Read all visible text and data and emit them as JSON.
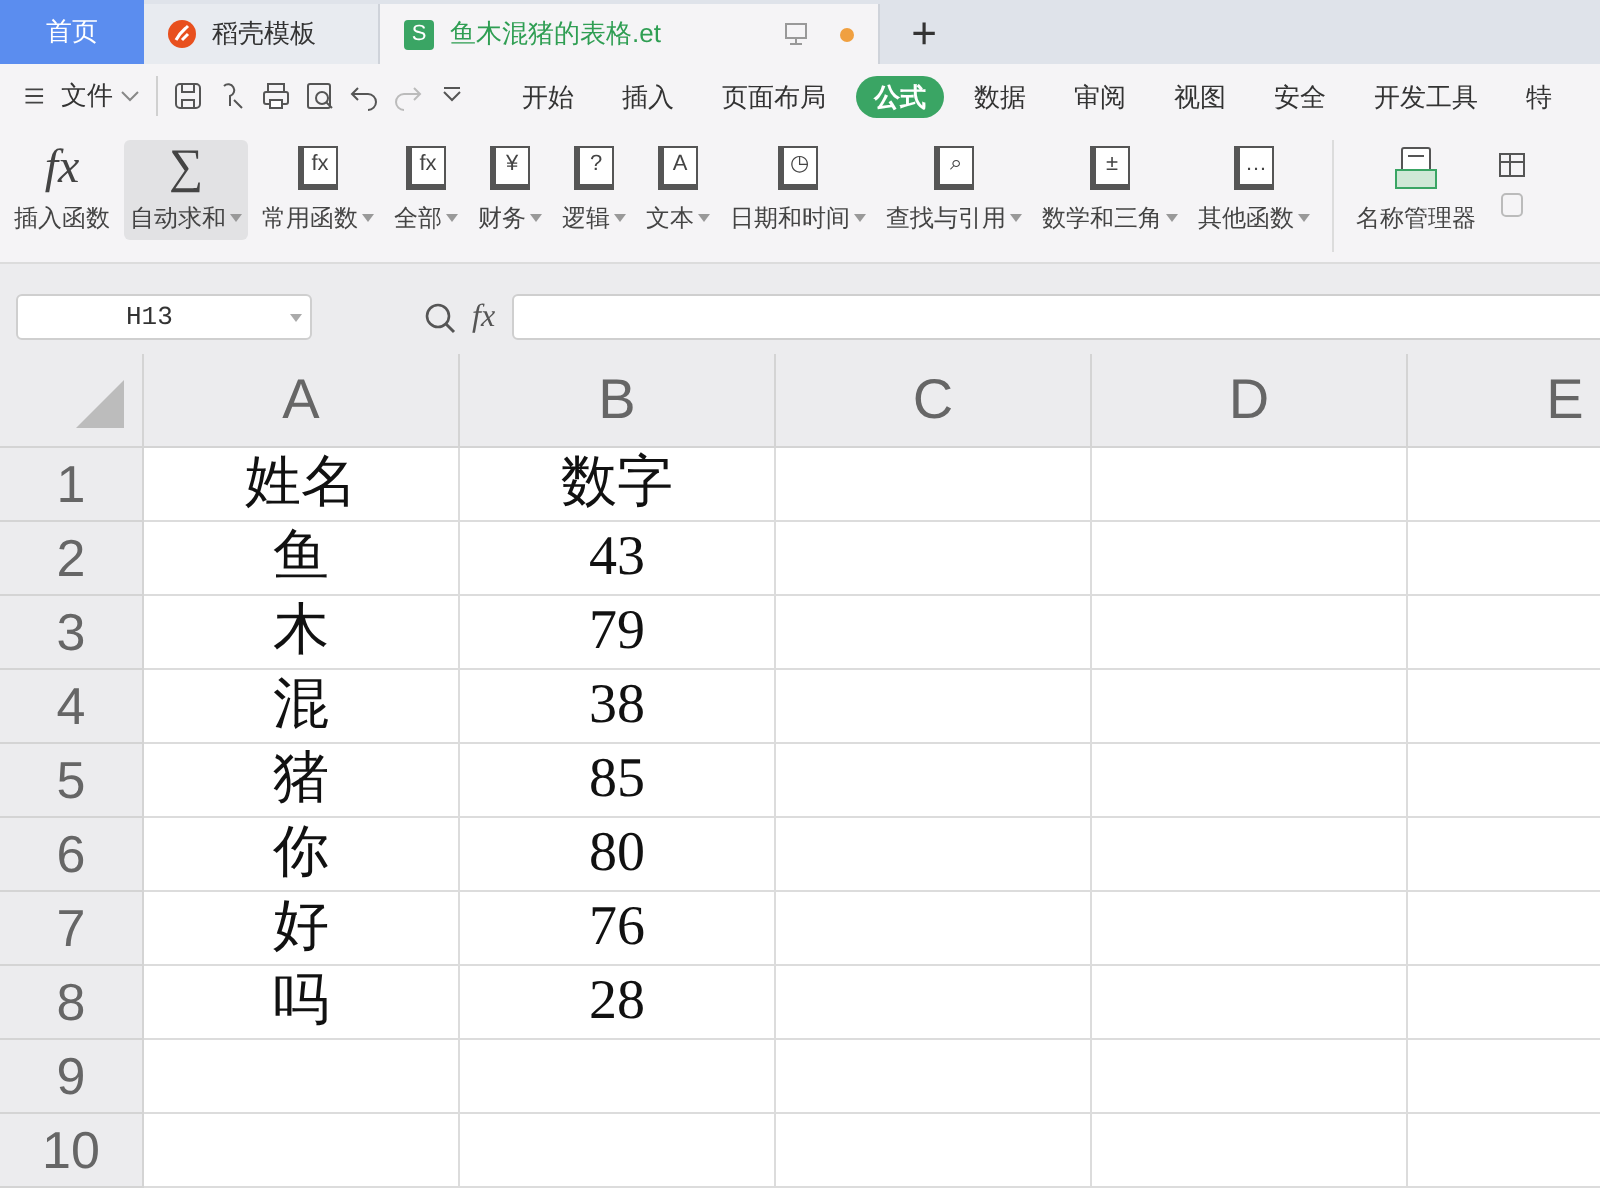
{
  "tabs": [
    {
      "kind": "home",
      "label": "首页",
      "selected": false
    },
    {
      "kind": "template",
      "label": "稻壳模板",
      "selected": false
    },
    {
      "kind": "sheet",
      "label": "鱼木混猪的表格.et",
      "icon_glyph": "S",
      "selected": true,
      "modified": true
    }
  ],
  "new_tab": "+",
  "menu": {
    "file": "文件",
    "tabs": [
      {
        "label": "开始",
        "selected": false
      },
      {
        "label": "插入",
        "selected": false
      },
      {
        "label": "页面布局",
        "selected": false
      },
      {
        "label": "公式",
        "selected": true
      },
      {
        "label": "数据",
        "selected": false
      },
      {
        "label": "审阅",
        "selected": false
      },
      {
        "label": "视图",
        "selected": false
      },
      {
        "label": "安全",
        "selected": false
      },
      {
        "label": "开发工具",
        "selected": false
      },
      {
        "label": "特",
        "selected": false
      }
    ]
  },
  "ribbon": [
    {
      "kind": "glyph",
      "glyph": "fx",
      "label": "插入函数",
      "dropdown": false,
      "selected": false
    },
    {
      "kind": "glyph",
      "glyph": "∑",
      "label": "自动求和",
      "dropdown": true,
      "selected": true
    },
    {
      "kind": "book",
      "glyph": "fx",
      "label": "常用函数",
      "dropdown": true,
      "selected": false
    },
    {
      "kind": "book",
      "glyph": "fx",
      "label": "全部",
      "dropdown": true,
      "selected": false
    },
    {
      "kind": "book",
      "glyph": "¥",
      "label": "财务",
      "dropdown": true,
      "selected": false
    },
    {
      "kind": "book",
      "glyph": "?",
      "label": "逻辑",
      "dropdown": true,
      "selected": false
    },
    {
      "kind": "book",
      "glyph": "A",
      "label": "文本",
      "dropdown": true,
      "selected": false
    },
    {
      "kind": "book",
      "glyph": "◷",
      "label": "日期和时间",
      "dropdown": true,
      "selected": false
    },
    {
      "kind": "book",
      "glyph": "⌕",
      "label": "查找与引用",
      "dropdown": true,
      "selected": false
    },
    {
      "kind": "book",
      "glyph": "±",
      "label": "数学和三角",
      "dropdown": true,
      "selected": false
    },
    {
      "kind": "book",
      "glyph": "…",
      "label": "其他函数",
      "dropdown": true,
      "selected": false
    },
    {
      "kind": "names",
      "label": "名称管理器",
      "dropdown": false,
      "selected": false
    }
  ],
  "formula_bar": {
    "name_box": "H13",
    "fx": "fx"
  },
  "sheet": {
    "columns": [
      "A",
      "B",
      "C",
      "D",
      "E"
    ],
    "rows": [
      {
        "header": "1",
        "cells": [
          "姓名",
          "数字"
        ]
      },
      {
        "header": "2",
        "cells": [
          "鱼",
          "43"
        ]
      },
      {
        "header": "3",
        "cells": [
          "木",
          "79"
        ]
      },
      {
        "header": "4",
        "cells": [
          "混",
          "38"
        ]
      },
      {
        "header": "5",
        "cells": [
          "猪",
          "85"
        ]
      },
      {
        "header": "6",
        "cells": [
          "你",
          "80"
        ]
      },
      {
        "header": "7",
        "cells": [
          "好",
          "76"
        ]
      },
      {
        "header": "8",
        "cells": [
          "吗",
          "28"
        ]
      },
      {
        "header": "9"
      },
      {
        "header": "10"
      }
    ]
  }
}
